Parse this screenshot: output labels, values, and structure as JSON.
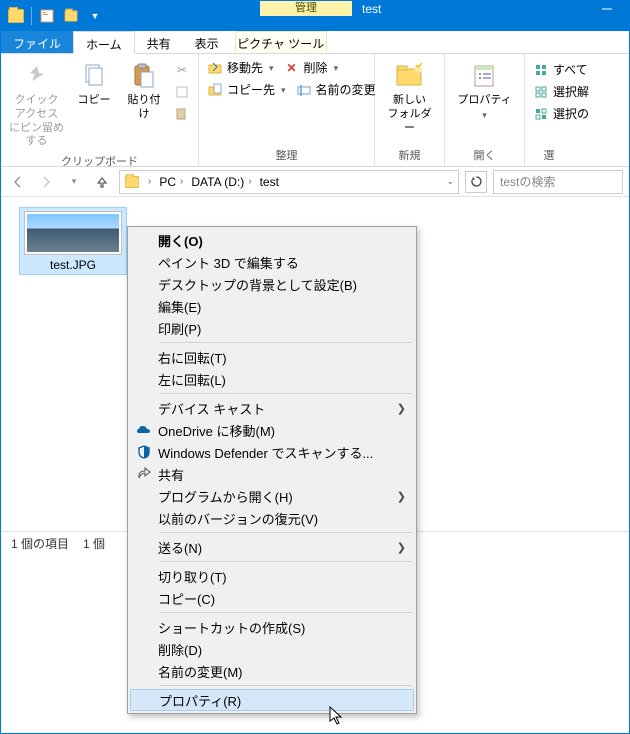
{
  "titlebar": {
    "manage": "管理",
    "title": "test",
    "picture_tools": "ピクチャ ツール"
  },
  "tabs": {
    "file": "ファイル",
    "home": "ホーム",
    "share": "共有",
    "view": "表示"
  },
  "ribbon": {
    "clipboard": {
      "pin_quick_access": "クイック アクセス\nにピン留めする",
      "copy": "コピー",
      "paste": "貼り付け",
      "label": "クリップボード"
    },
    "organize": {
      "move_to": "移動先",
      "delete": "削除",
      "copy_to": "コピー先",
      "rename": "名前の変更",
      "label": "整理"
    },
    "new": {
      "new_folder": "新しい\nフォルダー",
      "label": "新規"
    },
    "open": {
      "properties": "プロパティ",
      "label": "開く"
    },
    "select": {
      "select_all": "すべて",
      "select_none": "選択解",
      "invert": "選択の",
      "label": "選"
    }
  },
  "breadcrumb": {
    "pc": "PC",
    "drive": "DATA (D:)",
    "folder": "test"
  },
  "search": {
    "placeholder": "testの検索"
  },
  "file_item": {
    "name": "test.JPG"
  },
  "status": {
    "item_count": "1 個の項目",
    "selected": "1 個"
  },
  "context_menu": {
    "open": "開く(O)",
    "edit_paint3d": "ペイント 3D で編集する",
    "set_wallpaper": "デスクトップの背景として設定(B)",
    "edit": "編集(E)",
    "print": "印刷(P)",
    "rotate_right": "右に回転(T)",
    "rotate_left": "左に回転(L)",
    "cast": "デバイス キャスト",
    "onedrive": "OneDrive に移動(M)",
    "defender": "Windows Defender でスキャンする...",
    "share": "共有",
    "open_with": "プログラムから開く(H)",
    "restore_versions": "以前のバージョンの復元(V)",
    "send_to": "送る(N)",
    "cut": "切り取り(T)",
    "copy": "コピー(C)",
    "create_shortcut": "ショートカットの作成(S)",
    "delete": "削除(D)",
    "rename": "名前の変更(M)",
    "properties": "プロパティ(R)"
  }
}
